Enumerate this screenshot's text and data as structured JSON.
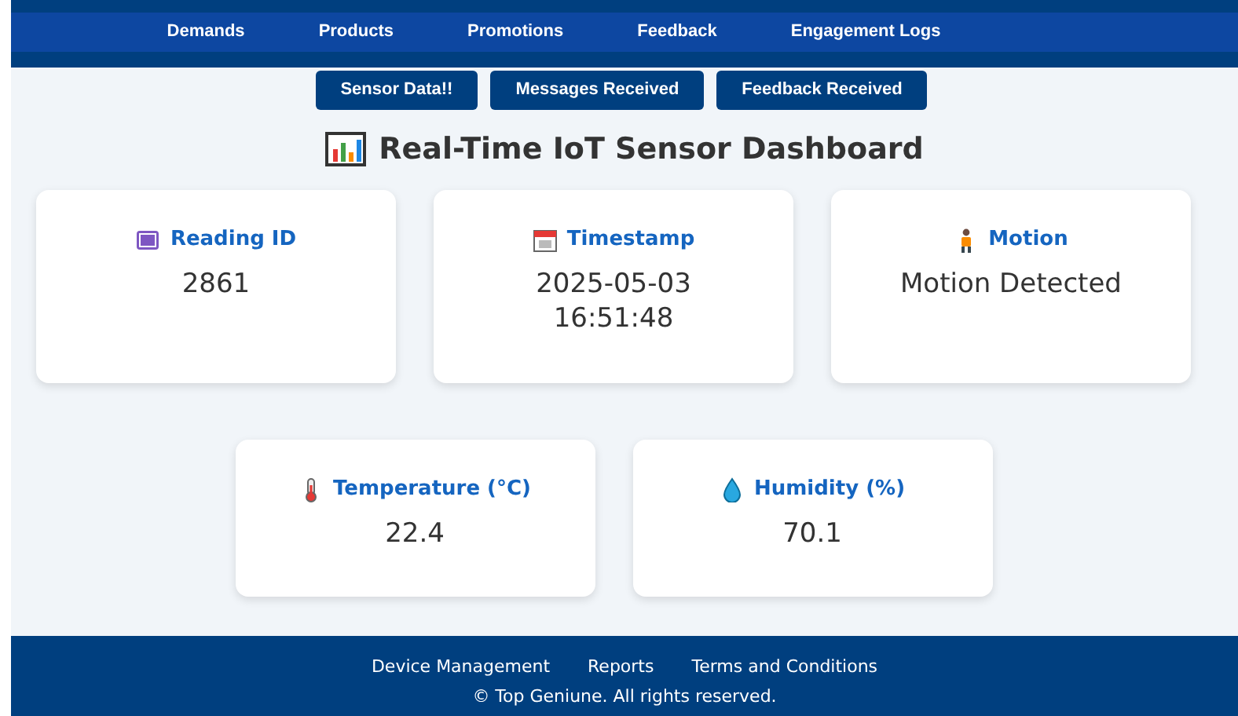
{
  "nav": [
    {
      "label": "Demands"
    },
    {
      "label": "Products"
    },
    {
      "label": "Promotions"
    },
    {
      "label": "Feedback"
    },
    {
      "label": "Engagement Logs"
    }
  ],
  "buttons": [
    {
      "label": "Sensor Data!!"
    },
    {
      "label": "Messages Received"
    },
    {
      "label": "Feedback Received"
    }
  ],
  "title": "Real-Time IoT Sensor Dashboard",
  "cards": [
    {
      "kind": "id",
      "label": "Reading ID",
      "value": "2861"
    },
    {
      "kind": "calendar",
      "label": "Timestamp",
      "value": "2025-05-03 16:51:48"
    },
    {
      "kind": "person",
      "label": "Motion",
      "value": "Motion Detected"
    },
    {
      "kind": "thermometer",
      "label": "Temperature (°C)",
      "value": "22.4"
    },
    {
      "kind": "drop",
      "label": "Humidity (%)",
      "value": "70.1"
    }
  ],
  "footer": {
    "links": [
      {
        "label": "Device Management"
      },
      {
        "label": "Reports"
      },
      {
        "label": "Terms and Conditions"
      }
    ],
    "copyright": "© Top Geniune. All rights reserved."
  }
}
